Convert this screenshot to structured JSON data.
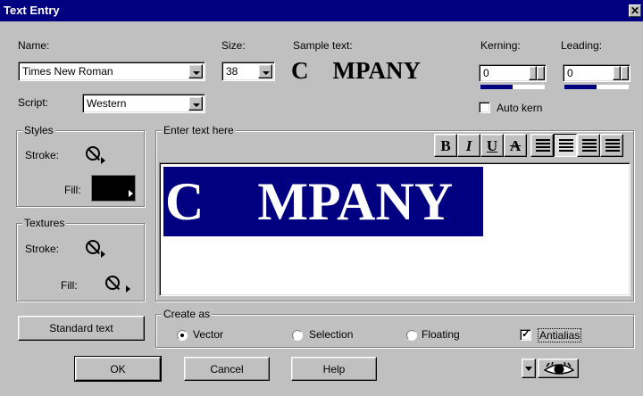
{
  "window": {
    "title": "Text Entry",
    "close": "✕"
  },
  "font": {
    "name_label": "Name:",
    "name_value": "Times New Roman",
    "size_label": "Size:",
    "size_value": "38",
    "script_label": "Script:",
    "script_value": "Western"
  },
  "sample": {
    "label": "Sample text:",
    "text": "C    MPANY"
  },
  "kerning": {
    "label": "Kerning:",
    "value": "0"
  },
  "leading": {
    "label": "Leading:",
    "value": "0"
  },
  "auto_kern": {
    "label": "Auto kern",
    "checked": false
  },
  "styles": {
    "title": "Styles",
    "stroke_label": "Stroke:",
    "fill_label": "Fill:",
    "fill_color": "#000000"
  },
  "textures": {
    "title": "Textures",
    "stroke_label": "Stroke:",
    "fill_label": "Fill:"
  },
  "editor": {
    "title": "Enter text here",
    "text": "C    MPANY",
    "selection_color": "#000080",
    "format_buttons": [
      "B",
      "I",
      "U",
      "A"
    ]
  },
  "create_as": {
    "title": "Create as",
    "options": [
      "Vector",
      "Selection",
      "Floating"
    ],
    "selected": "Vector",
    "antialias_label": "Antialias",
    "antialias_checked": true
  },
  "buttons": {
    "standard_text": "Standard text",
    "ok": "OK",
    "cancel": "Cancel",
    "help": "Help"
  },
  "icons": {
    "preview": "eye-icon",
    "no_style": "no-style-icon"
  }
}
